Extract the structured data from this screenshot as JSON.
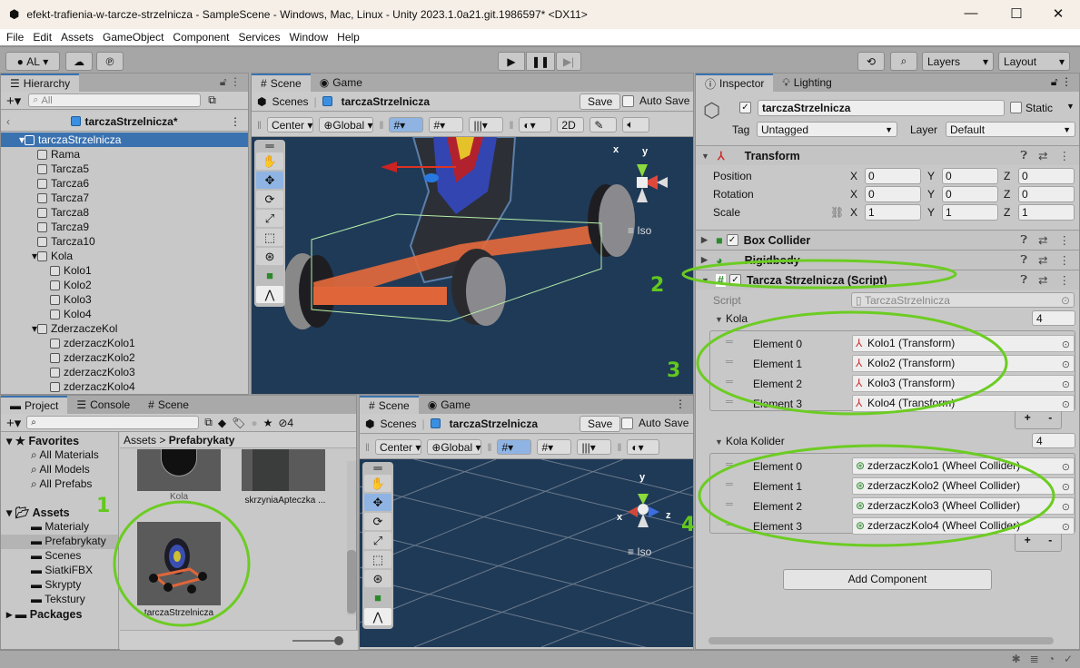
{
  "window": {
    "title": "efekt-trafienia-w-tarcze-strzelnicza - SampleScene - Windows, Mac, Linux - Unity 2023.1.0a21.git.1986597* <DX11>",
    "minimize": "—",
    "maximize": "☐",
    "close": "✕"
  },
  "menu": [
    "File",
    "Edit",
    "Assets",
    "GameObject",
    "Component",
    "Services",
    "Window",
    "Help"
  ],
  "toolbar": {
    "account": "AL",
    "layers": "Layers",
    "layout": "Layout"
  },
  "hierarchy": {
    "tab": "Hierarchy",
    "search_placeholder": "All",
    "scene": "tarczaStrzelnicza*",
    "items": [
      {
        "label": "tarczaStrzelnicza",
        "level": 1,
        "expanded": true,
        "selected": true
      },
      {
        "label": "Rama",
        "level": 2
      },
      {
        "label": "Tarcza5",
        "level": 2
      },
      {
        "label": "Tarcza6",
        "level": 2
      },
      {
        "label": "Tarcza7",
        "level": 2
      },
      {
        "label": "Tarcza8",
        "level": 2
      },
      {
        "label": "Tarcza9",
        "level": 2
      },
      {
        "label": "Tarcza10",
        "level": 2
      },
      {
        "label": "Kola",
        "level": 2,
        "expanded": true
      },
      {
        "label": "Kolo1",
        "level": 3
      },
      {
        "label": "Kolo2",
        "level": 3
      },
      {
        "label": "Kolo3",
        "level": 3
      },
      {
        "label": "Kolo4",
        "level": 3
      },
      {
        "label": "ZderzaczeKol",
        "level": 2,
        "expanded": true
      },
      {
        "label": "zderzaczKolo1",
        "level": 3
      },
      {
        "label": "zderzaczKolo2",
        "level": 3
      },
      {
        "label": "zderzaczKolo3",
        "level": 3
      },
      {
        "label": "zderzaczKolo4",
        "level": 3
      }
    ]
  },
  "scene_top": {
    "tabs": [
      "Scene",
      "Game"
    ],
    "breadcrumb_root": "Scenes",
    "breadcrumb_prefab": "tarczaStrzelnicza",
    "save": "Save",
    "auto_save": "Auto Save",
    "pivot": "Center",
    "space": "Global",
    "mode_2d": "2D",
    "projection": "Iso",
    "axis_x": "x",
    "axis_y": "y"
  },
  "scene_bottom": {
    "tabs": [
      "Scene",
      "Game"
    ],
    "breadcrumb_root": "Scenes",
    "breadcrumb_prefab": "tarczaStrzelnicza",
    "save": "Save",
    "auto_save": "Auto Save",
    "pivot": "Center",
    "space": "Global",
    "projection": "Iso",
    "axis_x": "x",
    "axis_y": "y",
    "axis_z": "z"
  },
  "project": {
    "tabs": [
      "Project",
      "Console",
      "Scene"
    ],
    "hidden_count": "4",
    "breadcrumb": [
      "Assets",
      "Prefabrykaty"
    ],
    "favorites": {
      "label": "Favorites",
      "items": [
        "All Materials",
        "All Models",
        "All Prefabs"
      ]
    },
    "assets": {
      "label": "Assets",
      "folders": [
        "Materialy",
        "Prefabrykaty",
        "Scenes",
        "SiatkiFBX",
        "Skrypty",
        "Tekstury"
      ],
      "selected": "Prefabrykaty"
    },
    "packages": "Packages",
    "grid": [
      "Kola",
      "skrzyniaApteczka ...",
      "tarczaStrzelnicza"
    ]
  },
  "inspector": {
    "tabs": [
      "Inspector",
      "Lighting"
    ],
    "object_name": "tarczaStrzelnicza",
    "static": "Static",
    "tag_label": "Tag",
    "tag": "Untagged",
    "layer_label": "Layer",
    "layer": "Default",
    "transform": {
      "title": "Transform",
      "rows": [
        {
          "label": "Position",
          "x": "0",
          "y": "0",
          "z": "0"
        },
        {
          "label": "Rotation",
          "x": "0",
          "y": "0",
          "z": "0"
        },
        {
          "label": "Scale",
          "x": "1",
          "y": "1",
          "z": "1"
        }
      ]
    },
    "box_collider": "Box Collider",
    "rigidbody": "Rigidbody",
    "script_comp": {
      "title": "Tarcza Strzelnicza (Script)",
      "script_label": "Script",
      "script_value": "TarczaStrzelnicza",
      "kola": {
        "label": "Kola",
        "size": "4",
        "elements": [
          {
            "label": "Element 0",
            "value": "Kolo1 (Transform)"
          },
          {
            "label": "Element 1",
            "value": "Kolo2 (Transform)"
          },
          {
            "label": "Element 2",
            "value": "Kolo3 (Transform)"
          },
          {
            "label": "Element 3",
            "value": "Kolo4 (Transform)"
          }
        ]
      },
      "kola_kolider": {
        "label": "Kola Kolider",
        "size": "4",
        "elements": [
          {
            "label": "Element 0",
            "value": "zderzaczKolo1 (Wheel Collider)"
          },
          {
            "label": "Element 1",
            "value": "zderzaczKolo2 (Wheel Collider)"
          },
          {
            "label": "Element 2",
            "value": "zderzaczKolo3 (Wheel Collider)"
          },
          {
            "label": "Element 3",
            "value": "zderzaczKolo4 (Wheel Collider)"
          }
        ]
      }
    },
    "add_component": "Add Component"
  },
  "annotations": [
    "1",
    "2",
    "3",
    "4"
  ],
  "colors": {
    "selection": "#3a72b0",
    "annotation": "#62c81e",
    "scene_bg": "#1f3a57",
    "panel": "#c8c8c8"
  }
}
